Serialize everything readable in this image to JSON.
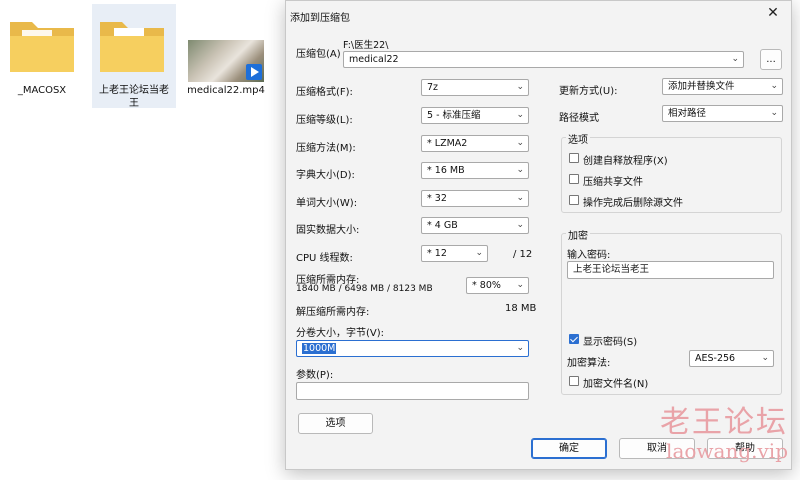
{
  "desktop": {
    "files": [
      {
        "label": "_MACOSX"
      },
      {
        "label": "上老王论坛当老王"
      },
      {
        "label": "medical22.mp4"
      }
    ]
  },
  "dialog": {
    "title": "添加到压缩包",
    "archive_label": "压缩包(A)",
    "archive_path": "F:\\医生22\\",
    "archive_name": "medical22",
    "browse_label": "...",
    "format_label": "压缩格式(F):",
    "format_value": "7z",
    "level_label": "压缩等级(L):",
    "level_value": "5 - 标准压缩",
    "method_label": "压缩方法(M):",
    "method_value": "* LZMA2",
    "dict_label": "字典大小(D):",
    "dict_value": "* 16 MB",
    "word_label": "单词大小(W):",
    "word_value": "* 32",
    "solid_label": "固实数据大小:",
    "solid_value": "* 4 GB",
    "cpu_label": "CPU 线程数:",
    "cpu_value": "* 12",
    "cpu_total": "/ 12",
    "mem_label": "压缩所需内存:",
    "mem_detail": "1840 MB / 6498 MB / 8123 MB",
    "mem_value": "* 80%",
    "decomp_label": "解压缩所需内存:",
    "decomp_value": "18 MB",
    "split_label": "分卷大小，字节(V):",
    "split_value": "1000M",
    "params_label": "参数(P):",
    "params_value": "",
    "options_button": "选项",
    "update_label": "更新方式(U):",
    "update_value": "添加并替换文件",
    "path_label": "路径模式",
    "path_value": "相对路径",
    "options_group": "选项",
    "opt_sfx": "创建自释放程序(X)",
    "opt_shared": "压缩共享文件",
    "opt_delete": "操作完成后删除源文件",
    "encrypt_group": "加密",
    "password_label": "输入密码:",
    "password_value": "上老王论坛当老王",
    "show_password": "显示密码(S)",
    "enc_method_label": "加密算法:",
    "enc_method_value": "AES-256",
    "encrypt_names": "加密文件名(N)",
    "ok_button": "确定",
    "cancel_button": "取消",
    "help_button": "帮助"
  },
  "watermark": {
    "text": "老王论坛",
    "url": "laowang.vip"
  }
}
